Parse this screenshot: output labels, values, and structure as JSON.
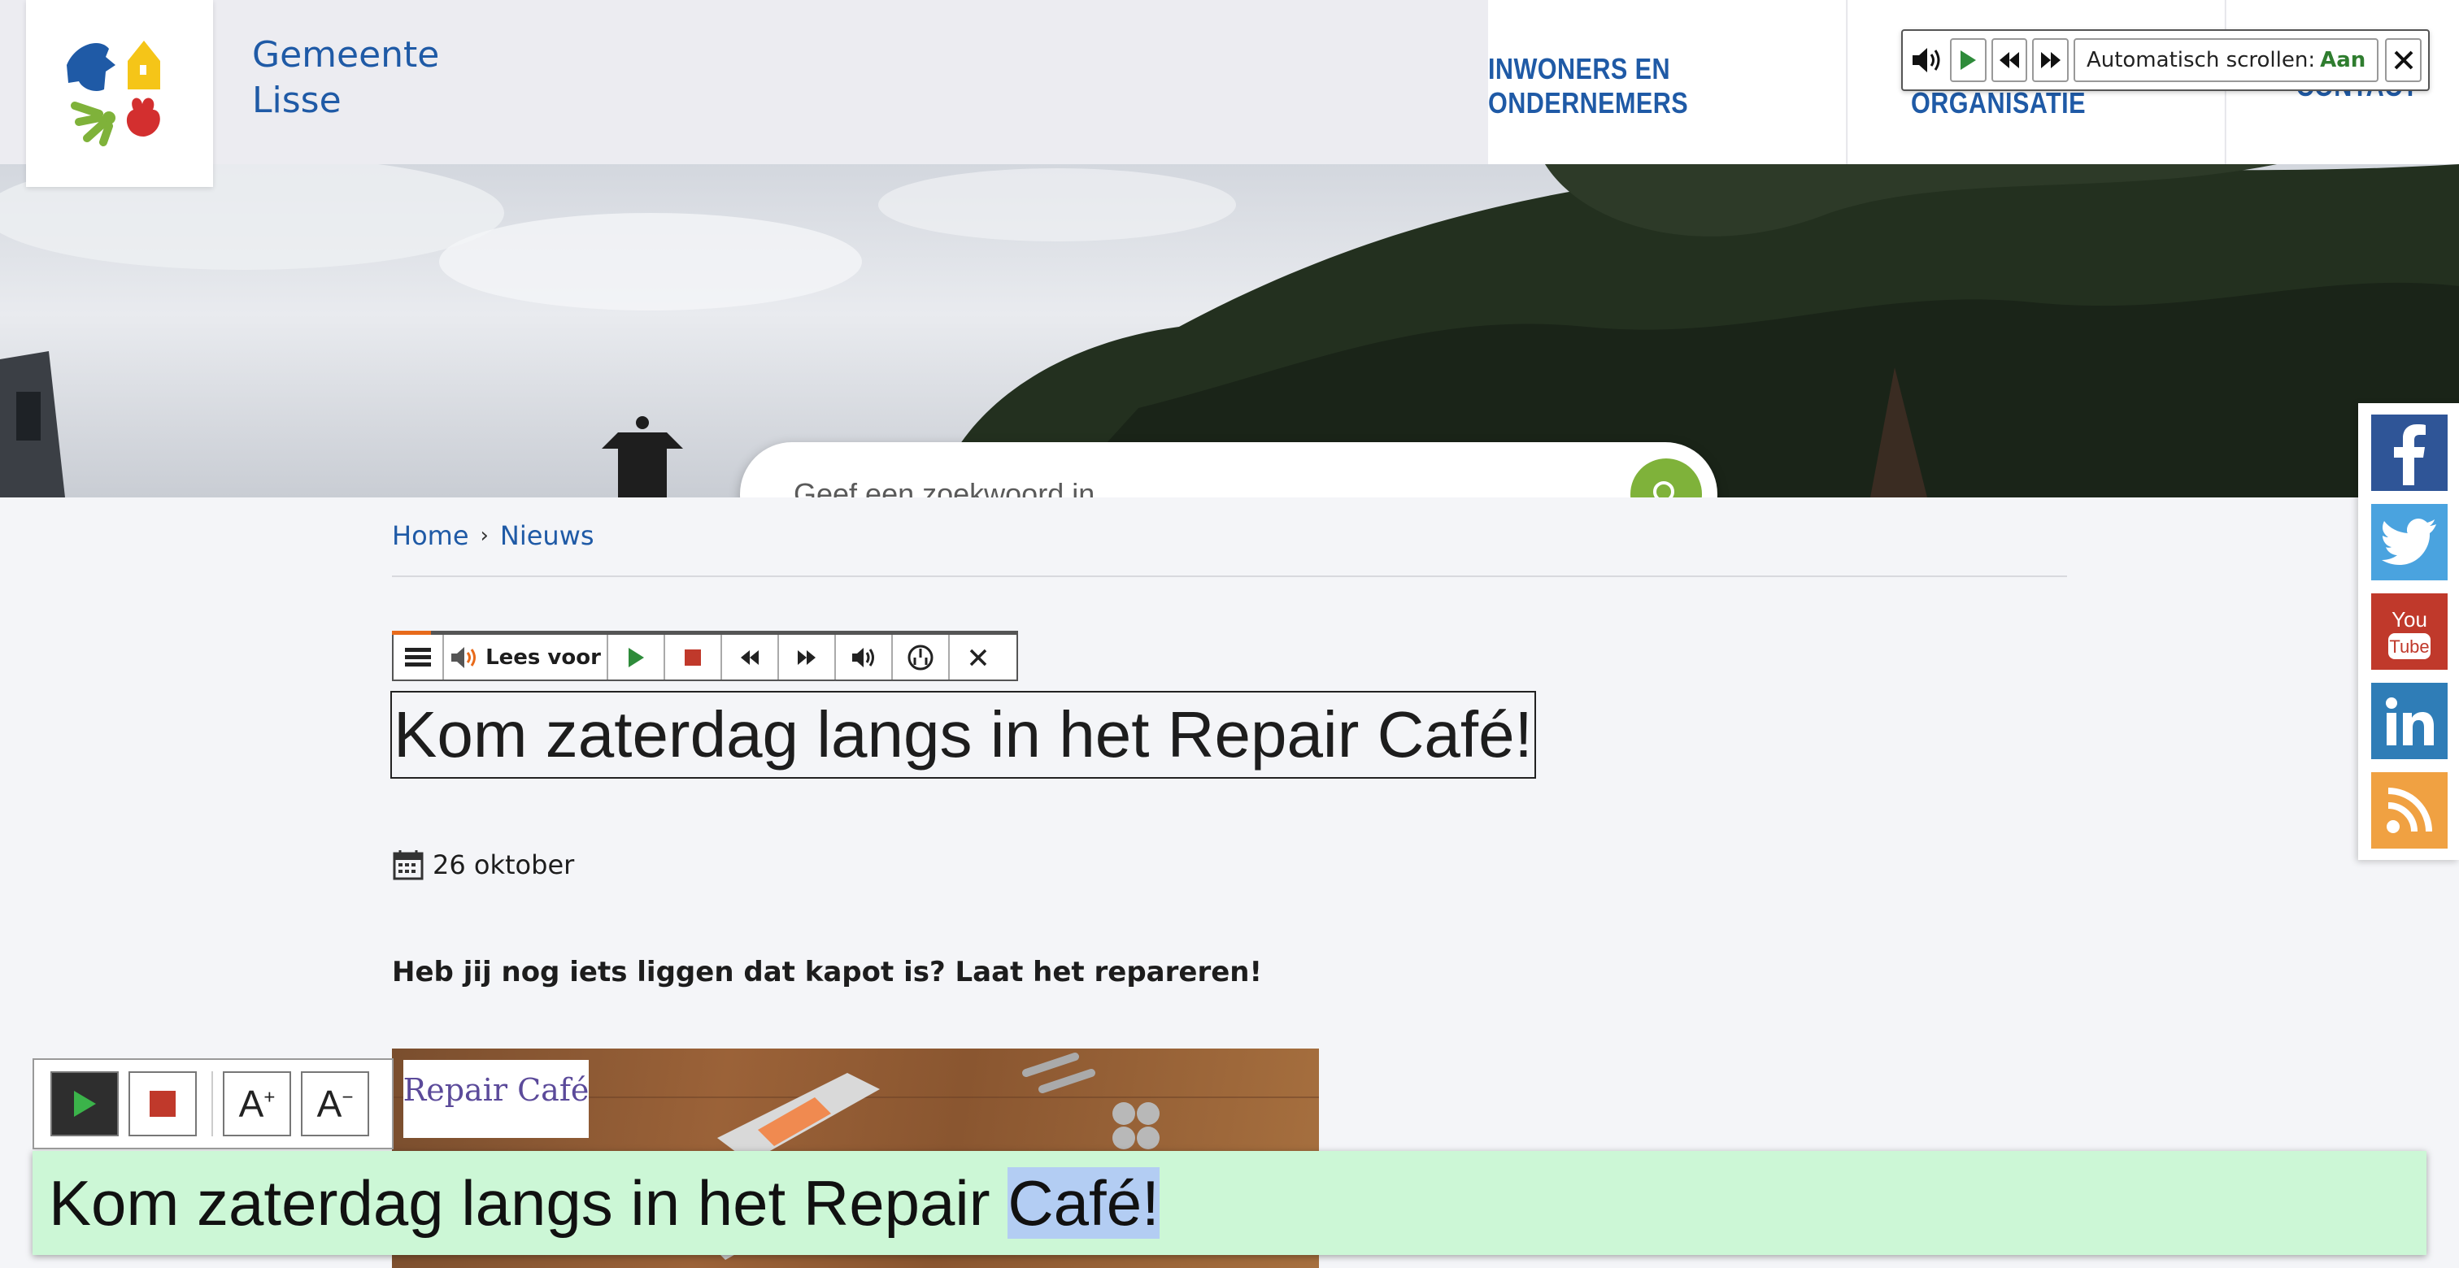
{
  "header": {
    "site_name_line1": "Gemeente",
    "site_name_line2": "Lisse",
    "nav": [
      "INWONERS EN ONDERNEMERS",
      "BESTUUR EN ORGANISATIE",
      "CONTACT"
    ]
  },
  "autoscroll": {
    "label": "Automatisch scrollen:",
    "value": "Aan",
    "icons": [
      "speaker-icon",
      "play-icon",
      "rewind-icon",
      "forward-icon",
      "close-icon"
    ]
  },
  "search": {
    "placeholder": "Geef een zoekwoord in"
  },
  "social": [
    "facebook",
    "twitter",
    "youtube",
    "linkedin",
    "rss"
  ],
  "breadcrumb": {
    "home": "Home",
    "current": "Nieuws"
  },
  "readspeaker": {
    "lees_voor": "Lees voor"
  },
  "article": {
    "title": "Kom zaterdag langs in het Repair Café!",
    "date": "26 oktober",
    "lead": "Heb jij nog iets liggen dat kapot is? Laat het repareren!",
    "image_logo_text": "Repair Café"
  },
  "reader_toolbar": {
    "font_up": "A",
    "font_down": "A"
  },
  "reader_panel": {
    "text_before": "Kom zaterdag langs in het Repair ",
    "text_highlight": "Café!"
  },
  "colors": {
    "brand_blue": "#1f5aa6",
    "search_green": "#7fb23a",
    "reader_green": "#ccf7d6",
    "highlight": "#b3cdf3"
  }
}
